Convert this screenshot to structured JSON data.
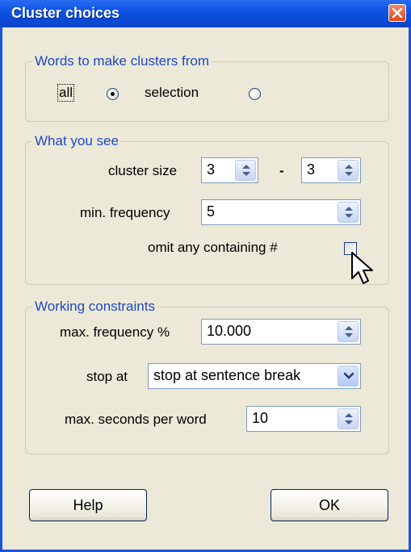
{
  "window": {
    "title": "Cluster choices"
  },
  "groups": {
    "words": {
      "legend": "Words to make clusters from",
      "all_label": "all",
      "selection_label": "selection",
      "selected": "all"
    },
    "what_you_see": {
      "legend": "What you see",
      "cluster_size_label": "cluster size",
      "cluster_size_min": "3",
      "separator": "-",
      "cluster_size_max": "3",
      "min_frequency_label": "min. frequency",
      "min_frequency_value": "5",
      "omit_label": "omit any containing #",
      "omit_checked": false
    },
    "working_constraints": {
      "legend": "Working constraints",
      "max_frequency_label": "max. frequency %",
      "max_frequency_value": "10.000",
      "stop_at_label": "stop at",
      "stop_at_value": "stop at sentence break",
      "max_seconds_label": "max. seconds per word",
      "max_seconds_value": "10"
    }
  },
  "buttons": {
    "help": "Help",
    "ok": "OK"
  },
  "icons": {
    "close": "close-icon",
    "spin": "spin-up-down-icon",
    "dropdown": "chevron-down-icon",
    "cursor": "mouse-pointer-icon"
  }
}
